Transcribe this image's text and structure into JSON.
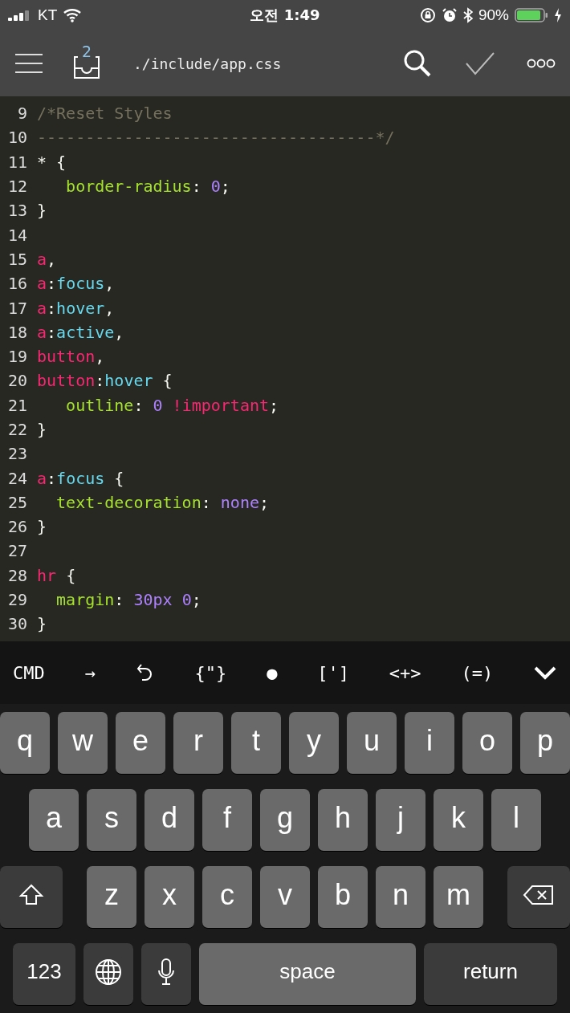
{
  "status_bar": {
    "carrier": "KT",
    "time": "오전 1:49",
    "battery": "90%"
  },
  "toolbar": {
    "badge": "2",
    "file_path": "./include/app.css"
  },
  "editor": {
    "lines": [
      {
        "number": "9",
        "tokens": [
          {
            "kind": "comment",
            "text": "/*Reset Styles"
          }
        ]
      },
      {
        "number": "10",
        "tokens": [
          {
            "kind": "comment",
            "text": "-----------------------------------*/"
          }
        ]
      },
      {
        "number": "11",
        "tokens": [
          {
            "kind": "plain",
            "text": "* {"
          }
        ]
      },
      {
        "number": "12",
        "tokens": [
          {
            "kind": "property",
            "text": "   border-radius"
          },
          {
            "kind": "plain",
            "text": ": "
          },
          {
            "kind": "number",
            "text": "0"
          },
          {
            "kind": "plain",
            "text": ";"
          }
        ]
      },
      {
        "number": "13",
        "tokens": [
          {
            "kind": "plain",
            "text": "}"
          }
        ]
      },
      {
        "number": "14"
      },
      {
        "number": "15",
        "tokens": [
          {
            "kind": "selector",
            "text": "a"
          },
          {
            "kind": "plain",
            "text": ","
          }
        ]
      },
      {
        "number": "16",
        "tokens": [
          {
            "kind": "selector",
            "text": "a"
          },
          {
            "kind": "plain",
            "text": ":"
          },
          {
            "kind": "pseudo",
            "text": "focus"
          },
          {
            "kind": "plain",
            "text": ","
          }
        ]
      },
      {
        "number": "17",
        "tokens": [
          {
            "kind": "selector",
            "text": "a"
          },
          {
            "kind": "plain",
            "text": ":"
          },
          {
            "kind": "pseudo",
            "text": "hover"
          },
          {
            "kind": "plain",
            "text": ","
          }
        ]
      },
      {
        "number": "18",
        "tokens": [
          {
            "kind": "selector",
            "text": "a"
          },
          {
            "kind": "plain",
            "text": ":"
          },
          {
            "kind": "pseudo",
            "text": "active"
          },
          {
            "kind": "plain",
            "text": ","
          }
        ]
      },
      {
        "number": "19",
        "tokens": [
          {
            "kind": "selector",
            "text": "button"
          },
          {
            "kind": "plain",
            "text": ","
          }
        ]
      },
      {
        "number": "20",
        "tokens": [
          {
            "kind": "selector",
            "text": "button"
          },
          {
            "kind": "plain",
            "text": ":"
          },
          {
            "kind": "pseudo",
            "text": "hover"
          },
          {
            "kind": "plain",
            "text": " {"
          }
        ]
      },
      {
        "number": "21",
        "tokens": [
          {
            "kind": "property",
            "text": "   outline"
          },
          {
            "kind": "plain",
            "text": ": "
          },
          {
            "kind": "number",
            "text": "0"
          },
          {
            "kind": "selector",
            "text": " !important"
          },
          {
            "kind": "plain",
            "text": ";"
          }
        ]
      },
      {
        "number": "22",
        "tokens": [
          {
            "kind": "plain",
            "text": "}"
          }
        ]
      },
      {
        "number": "23"
      },
      {
        "number": "24",
        "tokens": [
          {
            "kind": "selector",
            "text": "a"
          },
          {
            "kind": "plain",
            "text": ":"
          },
          {
            "kind": "pseudo",
            "text": "focus"
          },
          {
            "kind": "plain",
            "text": " {"
          }
        ]
      },
      {
        "number": "25",
        "tokens": [
          {
            "kind": "property",
            "text": "  text-decoration"
          },
          {
            "kind": "plain",
            "text": ": "
          },
          {
            "kind": "number",
            "text": "none"
          },
          {
            "kind": "plain",
            "text": ";"
          }
        ]
      },
      {
        "number": "26",
        "tokens": [
          {
            "kind": "plain",
            "text": "}"
          }
        ]
      },
      {
        "number": "27"
      },
      {
        "number": "28",
        "tokens": [
          {
            "kind": "selector",
            "text": "hr"
          },
          {
            "kind": "plain",
            "text": " {"
          }
        ]
      },
      {
        "number": "29",
        "tokens": [
          {
            "kind": "property",
            "text": "  margin"
          },
          {
            "kind": "plain",
            "text": ": "
          },
          {
            "kind": "number",
            "text": "30px 0"
          },
          {
            "kind": "plain",
            "text": ";"
          }
        ]
      },
      {
        "number": "30",
        "tokens": [
          {
            "kind": "plain",
            "text": "}"
          }
        ]
      }
    ]
  },
  "accessory_bar": [
    {
      "kind": "text",
      "label": "CMD"
    },
    {
      "kind": "text",
      "label": "→"
    },
    {
      "kind": "undo"
    },
    {
      "kind": "text",
      "label": "{\"}"
    },
    {
      "kind": "text",
      "label": "●"
    },
    {
      "kind": "text",
      "label": "[']"
    },
    {
      "kind": "text",
      "label": "<+>"
    },
    {
      "kind": "text",
      "label": "(=)"
    },
    {
      "kind": "dismiss"
    }
  ],
  "keyboard": [
    [
      {
        "kind": "letter",
        "label": "q"
      },
      {
        "kind": "letter",
        "label": "w"
      },
      {
        "kind": "letter",
        "label": "e"
      },
      {
        "kind": "letter",
        "label": "r"
      },
      {
        "kind": "letter",
        "label": "t"
      },
      {
        "kind": "letter",
        "label": "y"
      },
      {
        "kind": "letter",
        "label": "u"
      },
      {
        "kind": "letter",
        "label": "i"
      },
      {
        "kind": "letter",
        "label": "o"
      },
      {
        "kind": "letter",
        "label": "p"
      }
    ],
    [
      {
        "kind": "letter",
        "label": "a"
      },
      {
        "kind": "letter",
        "label": "s"
      },
      {
        "kind": "letter",
        "label": "d"
      },
      {
        "kind": "letter",
        "label": "f"
      },
      {
        "kind": "letter",
        "label": "g"
      },
      {
        "kind": "letter",
        "label": "h"
      },
      {
        "kind": "letter",
        "label": "j"
      },
      {
        "kind": "letter",
        "label": "k"
      },
      {
        "kind": "letter",
        "label": "l"
      }
    ],
    [
      {
        "kind": "shift"
      },
      {
        "kind": "letter",
        "label": "z"
      },
      {
        "kind": "letter",
        "label": "x"
      },
      {
        "kind": "letter",
        "label": "c"
      },
      {
        "kind": "letter",
        "label": "v"
      },
      {
        "kind": "letter",
        "label": "b"
      },
      {
        "kind": "letter",
        "label": "n"
      },
      {
        "kind": "letter",
        "label": "m"
      },
      {
        "kind": "delete"
      }
    ],
    [
      {
        "kind": "numbers",
        "label": "123"
      },
      {
        "kind": "globe"
      },
      {
        "kind": "mic"
      },
      {
        "kind": "space",
        "label": "space"
      },
      {
        "kind": "return",
        "label": "return"
      }
    ]
  ]
}
